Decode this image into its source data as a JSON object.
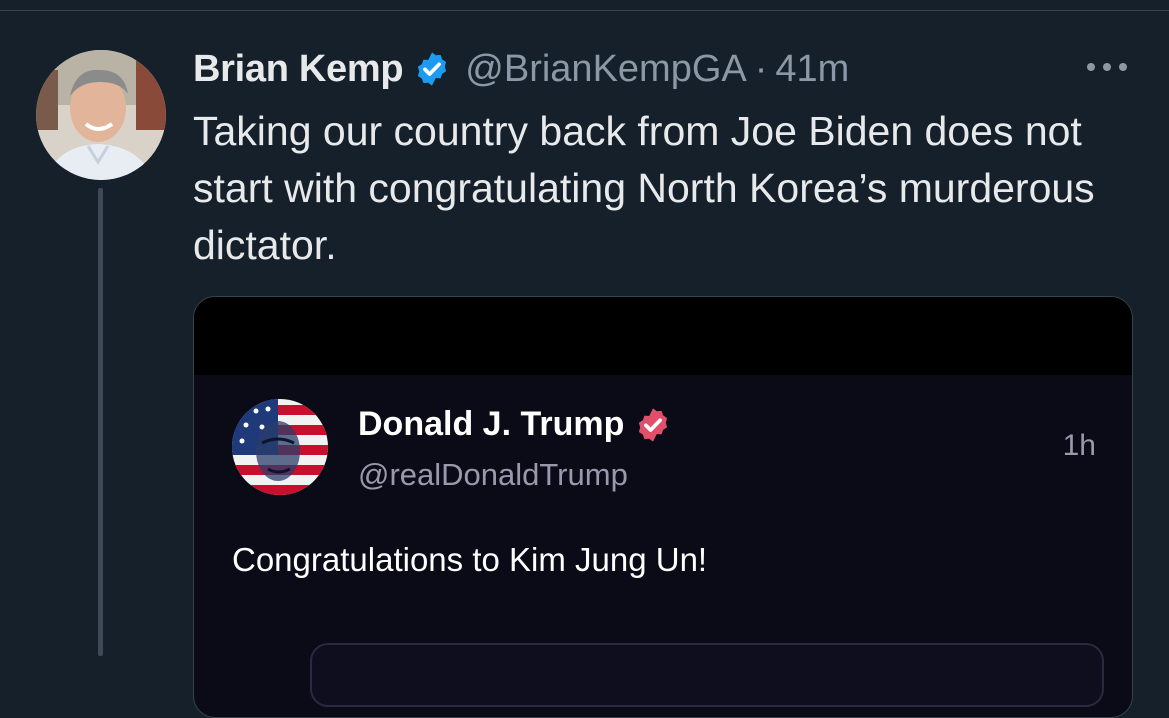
{
  "tweet": {
    "author_name": "Brian Kemp",
    "handle": "@BrianKempGA",
    "separator": "·",
    "time": "41m",
    "text": "Taking our country back from Joe Biden does not start with congratulating North Korea’s murderous dictator.",
    "verified_icon": "verified-badge-icon",
    "more_icon": "more-options-icon"
  },
  "quoted_post": {
    "author_name": "Donald J. Trump",
    "handle": "@realDonaldTrump",
    "time": "1h",
    "text": "Congratulations to Kim Jung Un!",
    "badge_icon": "verified-badge-icon"
  },
  "colors": {
    "background": "#15202b",
    "text_primary": "#e7e9ea",
    "text_secondary": "#8b98a5",
    "verified_blue": "#1d9bf0",
    "truth_badge_red": "#e24f6a",
    "quote_background": "#0b0a17"
  }
}
